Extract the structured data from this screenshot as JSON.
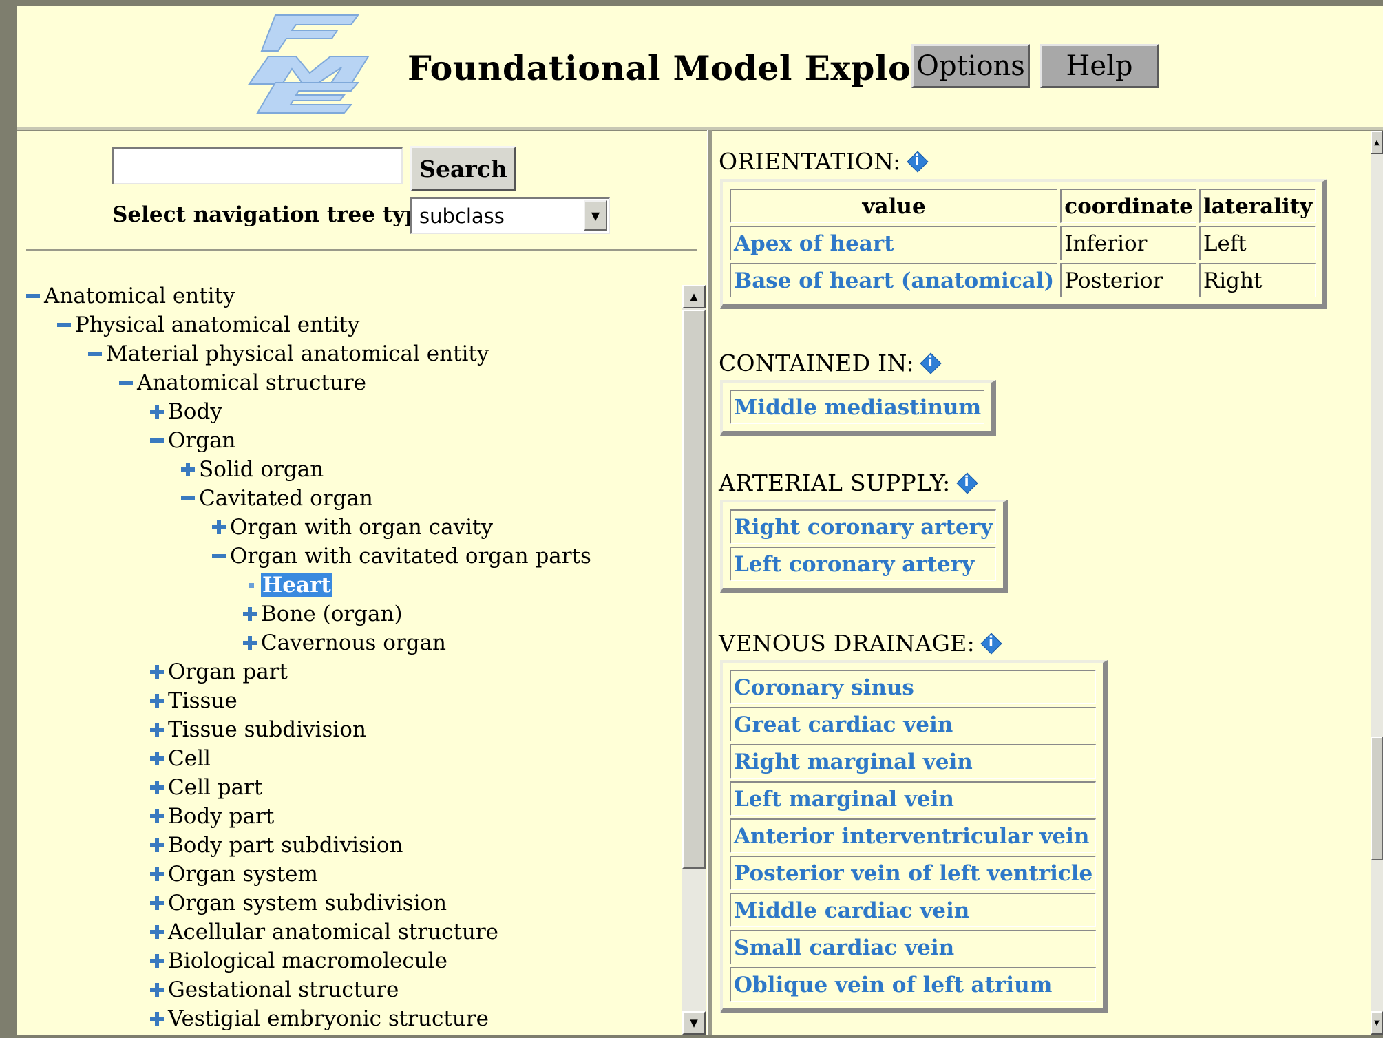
{
  "app": {
    "title": "Foundational Model Explorer",
    "logo_letters": "FME"
  },
  "header": {
    "options_label": "Options",
    "help_label": "Help"
  },
  "search": {
    "button_label": "Search",
    "value": ""
  },
  "nav_tree": {
    "select_label": "Select navigation tree type:",
    "selected_value": "subclass",
    "nodes": [
      {
        "label": "Anatomical entity",
        "state": "minus"
      },
      {
        "label": "Physical anatomical entity",
        "state": "minus"
      },
      {
        "label": "Material physical anatomical entity",
        "state": "minus"
      },
      {
        "label": "Anatomical structure",
        "state": "minus"
      },
      {
        "label": "Body",
        "state": "plus"
      },
      {
        "label": "Organ",
        "state": "minus"
      },
      {
        "label": "Solid organ",
        "state": "plus"
      },
      {
        "label": "Cavitated organ",
        "state": "minus"
      },
      {
        "label": "Organ with organ cavity",
        "state": "plus"
      },
      {
        "label": "Organ with cavitated organ parts",
        "state": "minus"
      },
      {
        "label": "Heart",
        "state": "leaf",
        "selected": true
      },
      {
        "label": "Bone (organ)",
        "state": "plus"
      },
      {
        "label": "Cavernous organ",
        "state": "plus"
      },
      {
        "label": "Organ part",
        "state": "plus"
      },
      {
        "label": "Tissue",
        "state": "plus"
      },
      {
        "label": "Tissue subdivision",
        "state": "plus"
      },
      {
        "label": "Cell",
        "state": "plus"
      },
      {
        "label": "Cell part",
        "state": "plus"
      },
      {
        "label": "Body part",
        "state": "plus"
      },
      {
        "label": "Body part subdivision",
        "state": "plus"
      },
      {
        "label": "Organ system",
        "state": "plus"
      },
      {
        "label": "Organ system subdivision",
        "state": "plus"
      },
      {
        "label": "Acellular anatomical structure",
        "state": "plus"
      },
      {
        "label": "Biological macromolecule",
        "state": "plus"
      },
      {
        "label": "Gestational structure",
        "state": "plus"
      },
      {
        "label": "Vestigial embryonic structure",
        "state": "plus"
      }
    ]
  },
  "details": {
    "orientation": {
      "heading": "ORIENTATION:",
      "columns": [
        "value",
        "coordinate",
        "laterality"
      ],
      "rows": [
        [
          "Apex of heart",
          "Inferior",
          "Left"
        ],
        [
          "Base of heart (anatomical)",
          "Posterior",
          "Right"
        ]
      ]
    },
    "contained_in": {
      "heading": "CONTAINED IN:",
      "items": [
        "Middle mediastinum"
      ]
    },
    "arterial_supply": {
      "heading": "ARTERIAL SUPPLY:",
      "items": [
        "Right coronary artery",
        "Left coronary artery"
      ]
    },
    "venous_drainage": {
      "heading": "VENOUS DRAINAGE:",
      "items": [
        "Coronary sinus",
        "Great cardiac vein",
        "Right marginal vein",
        "Left marginal vein",
        "Anterior interventricular vein",
        "Posterior vein of left ventricle",
        "Middle cardiac vein",
        "Small cardiac vein",
        "Oblique vein of left atrium"
      ]
    }
  },
  "colors": {
    "background": "#FFFFD7",
    "link": "#2E78C8",
    "tree_icon": "#3A7ABF",
    "selection": "#3A8ADF"
  },
  "icons": {
    "expand": "plus-icon",
    "collapse": "minus-icon",
    "leaf": "leaf-bullet-icon",
    "info": "info-diamond-icon"
  }
}
